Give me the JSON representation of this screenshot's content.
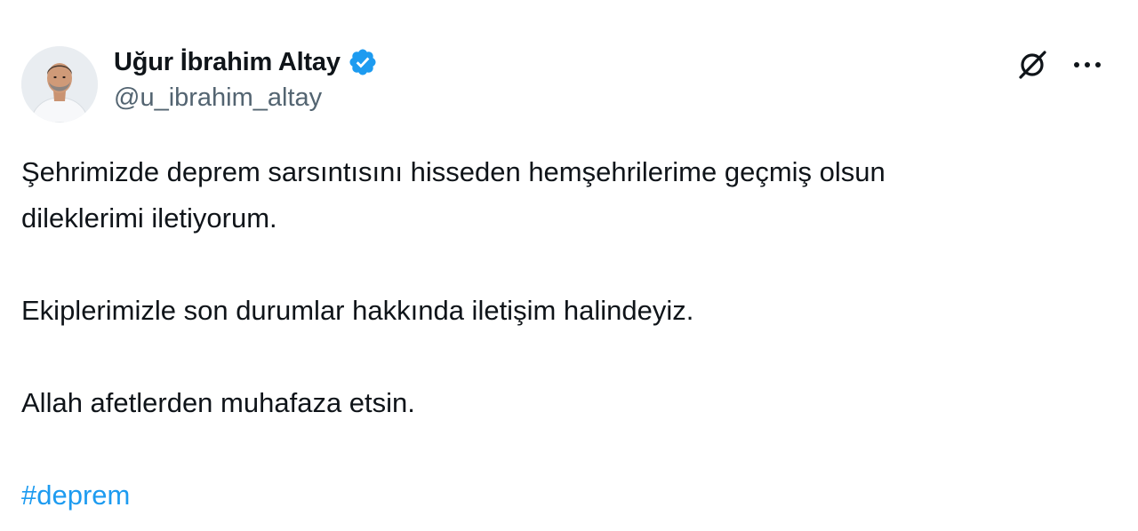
{
  "author": {
    "display_name": "Uğur İbrahim Altay",
    "handle": "@u_ibrahim_altay",
    "verified": true,
    "verified_color": "#1d9bf0"
  },
  "actions": {
    "grok_icon": "grok-icon",
    "more_icon": "more-icon"
  },
  "tweet": {
    "line1": "Şehrimizde deprem sarsıntısını hisseden hemşehrilerime geçmiş olsun",
    "line2": "dileklerimi iletiyorum.",
    "paragraph2": "Ekiplerimizle son durumlar hakkında iletişim halindeyiz.",
    "paragraph3": "Allah afetlerden muhafaza etsin.",
    "hashtag": "#deprem",
    "hashtag_color": "#1d9bf0"
  }
}
